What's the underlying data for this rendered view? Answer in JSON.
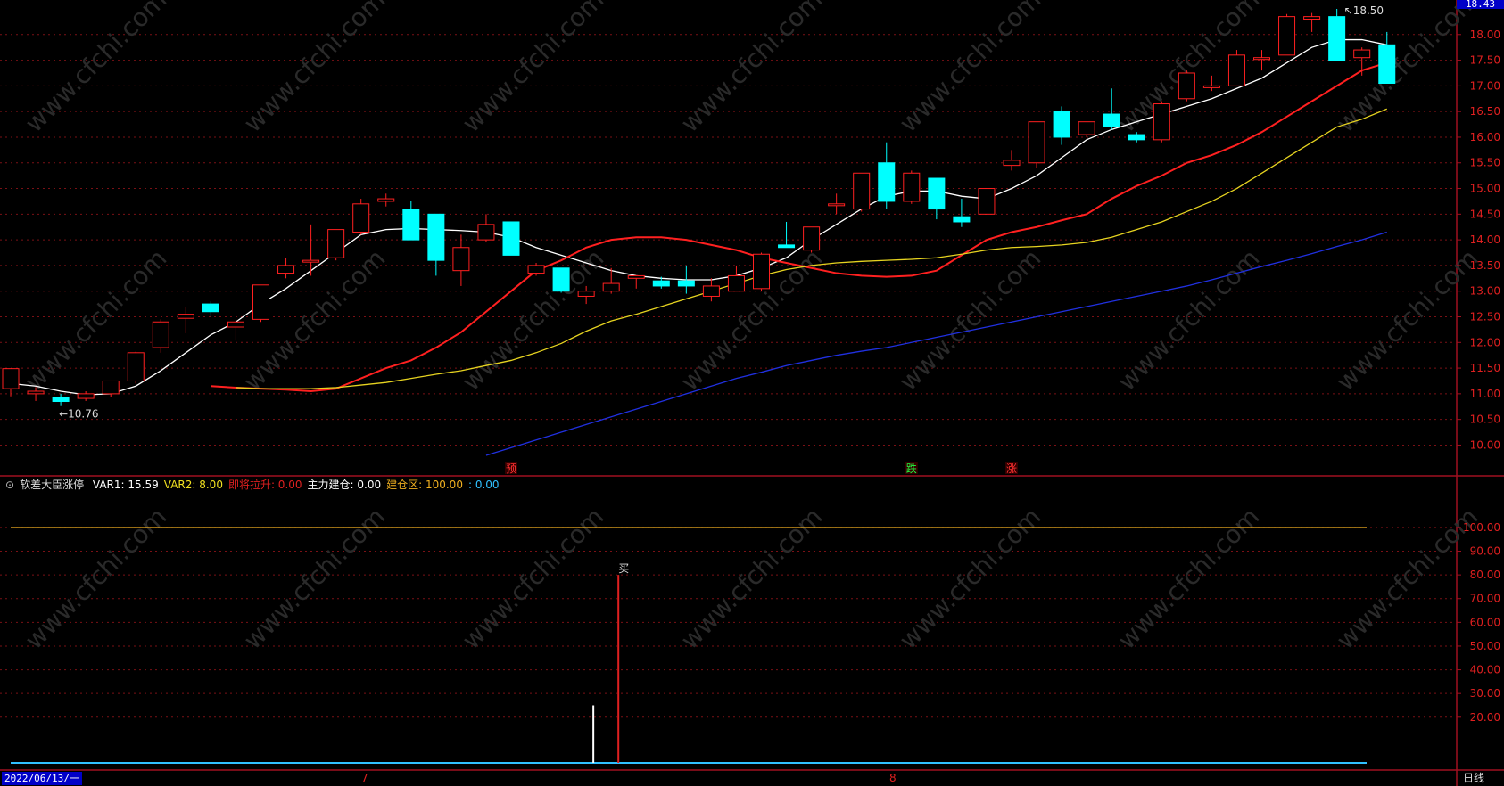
{
  "chart_data": {
    "type": "candlestick",
    "period_label": "日线",
    "start_date": "2022/06/13/一",
    "month_markers": [
      "7",
      "8"
    ],
    "current_price_badge": "18.43",
    "high_marker": "18.50",
    "low_marker": "10.76",
    "price_axis": {
      "min": 9.4,
      "max": 18.5,
      "ticks": [
        "10.00",
        "10.50",
        "11.00",
        "11.50",
        "12.00",
        "12.50",
        "13.00",
        "13.50",
        "14.00",
        "14.50",
        "15.00",
        "15.50",
        "16.00",
        "16.50",
        "17.00",
        "17.50",
        "18.00"
      ]
    },
    "candles": [
      [
        11.1,
        11.49,
        11.45,
        10.95
      ],
      [
        11.0,
        11.05,
        11.13,
        10.86
      ],
      [
        10.93,
        10.85,
        11.0,
        10.76
      ],
      [
        10.91,
        11.0,
        11.05,
        10.86
      ],
      [
        11.0,
        11.25,
        11.25,
        10.93
      ],
      [
        11.25,
        11.8,
        11.82,
        11.2
      ],
      [
        11.9,
        12.4,
        12.45,
        11.8
      ],
      [
        12.47,
        12.55,
        12.7,
        12.18
      ],
      [
        12.75,
        12.6,
        12.8,
        12.5
      ],
      [
        12.3,
        12.4,
        12.4,
        12.05
      ],
      [
        12.45,
        13.12,
        13.12,
        12.4
      ],
      [
        13.35,
        13.5,
        13.65,
        13.25
      ],
      [
        13.6,
        13.6,
        14.3,
        13.3
      ],
      [
        13.65,
        14.2,
        14.2,
        13.6
      ],
      [
        14.15,
        14.7,
        14.8,
        14.1
      ],
      [
        14.75,
        14.8,
        14.9,
        14.65
      ],
      [
        14.6,
        14.0,
        14.75,
        14.0
      ],
      [
        14.5,
        13.6,
        14.5,
        13.3
      ],
      [
        13.4,
        13.85,
        14.1,
        13.1
      ],
      [
        14.0,
        14.3,
        14.5,
        13.95
      ],
      [
        14.35,
        13.7,
        14.35,
        13.7
      ],
      [
        13.35,
        13.5,
        13.55,
        13.3
      ],
      [
        13.45,
        13.0,
        13.45,
        12.97
      ],
      [
        12.9,
        13.0,
        13.1,
        12.75
      ],
      [
        13.0,
        13.15,
        13.45,
        12.95
      ],
      [
        13.25,
        13.3,
        13.3,
        13.05
      ],
      [
        13.2,
        13.1,
        13.28,
        13.05
      ],
      [
        13.2,
        13.1,
        13.5,
        12.95
      ],
      [
        12.9,
        13.1,
        13.25,
        12.8
      ],
      [
        13.0,
        13.3,
        13.5,
        13.0
      ],
      [
        13.05,
        13.72,
        13.75,
        13.0
      ],
      [
        13.9,
        13.85,
        14.35,
        13.85
      ],
      [
        13.8,
        14.25,
        14.25,
        13.75
      ],
      [
        14.7,
        14.7,
        14.9,
        14.5
      ],
      [
        14.6,
        15.3,
        15.3,
        14.55
      ],
      [
        15.5,
        14.75,
        15.9,
        14.6
      ],
      [
        14.75,
        15.3,
        15.35,
        14.7
      ],
      [
        15.2,
        14.6,
        15.2,
        14.4
      ],
      [
        14.45,
        14.35,
        14.8,
        14.25
      ],
      [
        14.5,
        15.0,
        15.0,
        14.5
      ],
      [
        15.45,
        15.55,
        15.75,
        15.35
      ],
      [
        15.5,
        16.3,
        16.3,
        15.4
      ],
      [
        16.5,
        16.0,
        16.6,
        15.85
      ],
      [
        16.05,
        16.3,
        16.3,
        16.0
      ],
      [
        16.45,
        16.2,
        16.95,
        16.15
      ],
      [
        16.05,
        15.95,
        16.1,
        15.9
      ],
      [
        15.95,
        16.65,
        16.7,
        15.9
      ],
      [
        16.75,
        17.25,
        17.3,
        16.7
      ],
      [
        17.0,
        17.0,
        17.2,
        16.9
      ],
      [
        17.0,
        17.6,
        17.7,
        17.0
      ],
      [
        17.55,
        17.55,
        17.7,
        17.3
      ],
      [
        17.6,
        18.35,
        18.4,
        17.6
      ],
      [
        18.3,
        18.35,
        18.42,
        18.05
      ],
      [
        18.35,
        17.5,
        18.5,
        17.5
      ],
      [
        17.55,
        17.7,
        17.75,
        17.2
      ],
      [
        17.8,
        17.05,
        18.05,
        17.05
      ]
    ],
    "ma_lines": [
      {
        "name": "MA5",
        "color": "#ffffff",
        "values": [
          11.2,
          11.15,
          11.05,
          10.98,
          11.0,
          11.15,
          11.45,
          11.8,
          12.15,
          12.4,
          12.75,
          13.05,
          13.4,
          13.75,
          14.1,
          14.2,
          14.22,
          14.2,
          14.18,
          14.15,
          14.05,
          13.85,
          13.7,
          13.55,
          13.4,
          13.3,
          13.25,
          13.22,
          13.22,
          13.3,
          13.45,
          13.65,
          14.0,
          14.3,
          14.6,
          14.85,
          14.95,
          14.95,
          14.85,
          14.8,
          15.0,
          15.25,
          15.6,
          15.95,
          16.15,
          16.3,
          16.45,
          16.6,
          16.75,
          16.95,
          17.15,
          17.45,
          17.75,
          17.9,
          17.9,
          17.8
        ]
      },
      {
        "name": "MA10",
        "color": "#ff2020",
        "values": [
          11.15,
          11.12,
          11.1,
          11.08,
          11.05,
          11.1,
          11.3,
          11.5,
          11.65,
          11.9,
          12.2,
          12.6,
          13.0,
          13.4,
          13.6,
          13.85,
          14.0,
          14.05,
          14.05,
          14.0,
          13.9,
          13.8,
          13.65,
          13.55,
          13.45,
          13.35,
          13.3,
          13.28,
          13.3,
          13.4,
          13.7,
          14.0,
          14.15,
          14.25,
          14.38,
          14.5,
          14.8,
          15.05,
          15.25,
          15.5,
          15.65,
          15.85,
          16.1,
          16.4,
          16.7,
          17.0,
          17.3,
          17.45
        ]
      },
      {
        "name": "MA20",
        "color": "#e6d320",
        "values": [
          11.12,
          11.1,
          11.1,
          11.1,
          11.12,
          11.17,
          11.22,
          11.3,
          11.38,
          11.45,
          11.55,
          11.65,
          11.8,
          11.98,
          12.22,
          12.42,
          12.55,
          12.7,
          12.85,
          13.0,
          13.15,
          13.3,
          13.42,
          13.5,
          13.55,
          13.58,
          13.6,
          13.62,
          13.65,
          13.72,
          13.8,
          13.85,
          13.87,
          13.9,
          13.95,
          14.05,
          14.2,
          14.35,
          14.55,
          14.75,
          15.0,
          15.3,
          15.6,
          15.9,
          16.2,
          16.35,
          16.55
        ]
      },
      {
        "name": "MA60",
        "color": "#2030e0",
        "values": [
          9.8,
          9.95,
          10.1,
          10.25,
          10.4,
          10.55,
          10.7,
          10.85,
          11.0,
          11.15,
          11.3,
          11.42,
          11.55,
          11.65,
          11.75,
          11.83,
          11.9,
          12.0,
          12.1,
          12.2,
          12.3,
          12.4,
          12.5,
          12.6,
          12.7,
          12.8,
          12.9,
          13.0,
          13.1,
          13.22,
          13.35,
          13.48,
          13.6,
          13.73,
          13.87,
          14.0,
          14.15
        ]
      }
    ],
    "price_signals": [
      {
        "text": "预",
        "index": 20,
        "color": "#ff3030"
      },
      {
        "text": "跌",
        "index": 36,
        "color": "#20ff40"
      },
      {
        "text": "涨",
        "index": 40,
        "color": "#ff3030"
      }
    ],
    "indicator": {
      "name": "软差大臣涨停",
      "items": [
        {
          "label": "VAR1:",
          "value": "15.59",
          "color": "#ffffff"
        },
        {
          "label": "VAR2:",
          "value": "8.00",
          "color": "#f0e020"
        },
        {
          "label": "即将拉升:",
          "value": "0.00",
          "color": "#e02020"
        },
        {
          "label": "主力建仓:",
          "value": "0.00",
          "color": "#ffffff"
        },
        {
          "label": "建仓区:",
          "value": "100.00",
          "color": "#f0b020"
        },
        {
          "label": ":",
          "value": "0.00",
          "color": "#30c0ff"
        }
      ],
      "axis": {
        "min": 0,
        "max": 115,
        "ticks": [
          "20.00",
          "30.00",
          "40.00",
          "50.00",
          "60.00",
          "70.00",
          "80.00",
          "90.00",
          "100.00"
        ]
      },
      "level_line": 100,
      "bars": [
        {
          "index": 23,
          "value": 25,
          "color": "#ffffff"
        },
        {
          "index": 24,
          "value": 80,
          "color": "#e02020",
          "label": "买"
        }
      ]
    }
  }
}
